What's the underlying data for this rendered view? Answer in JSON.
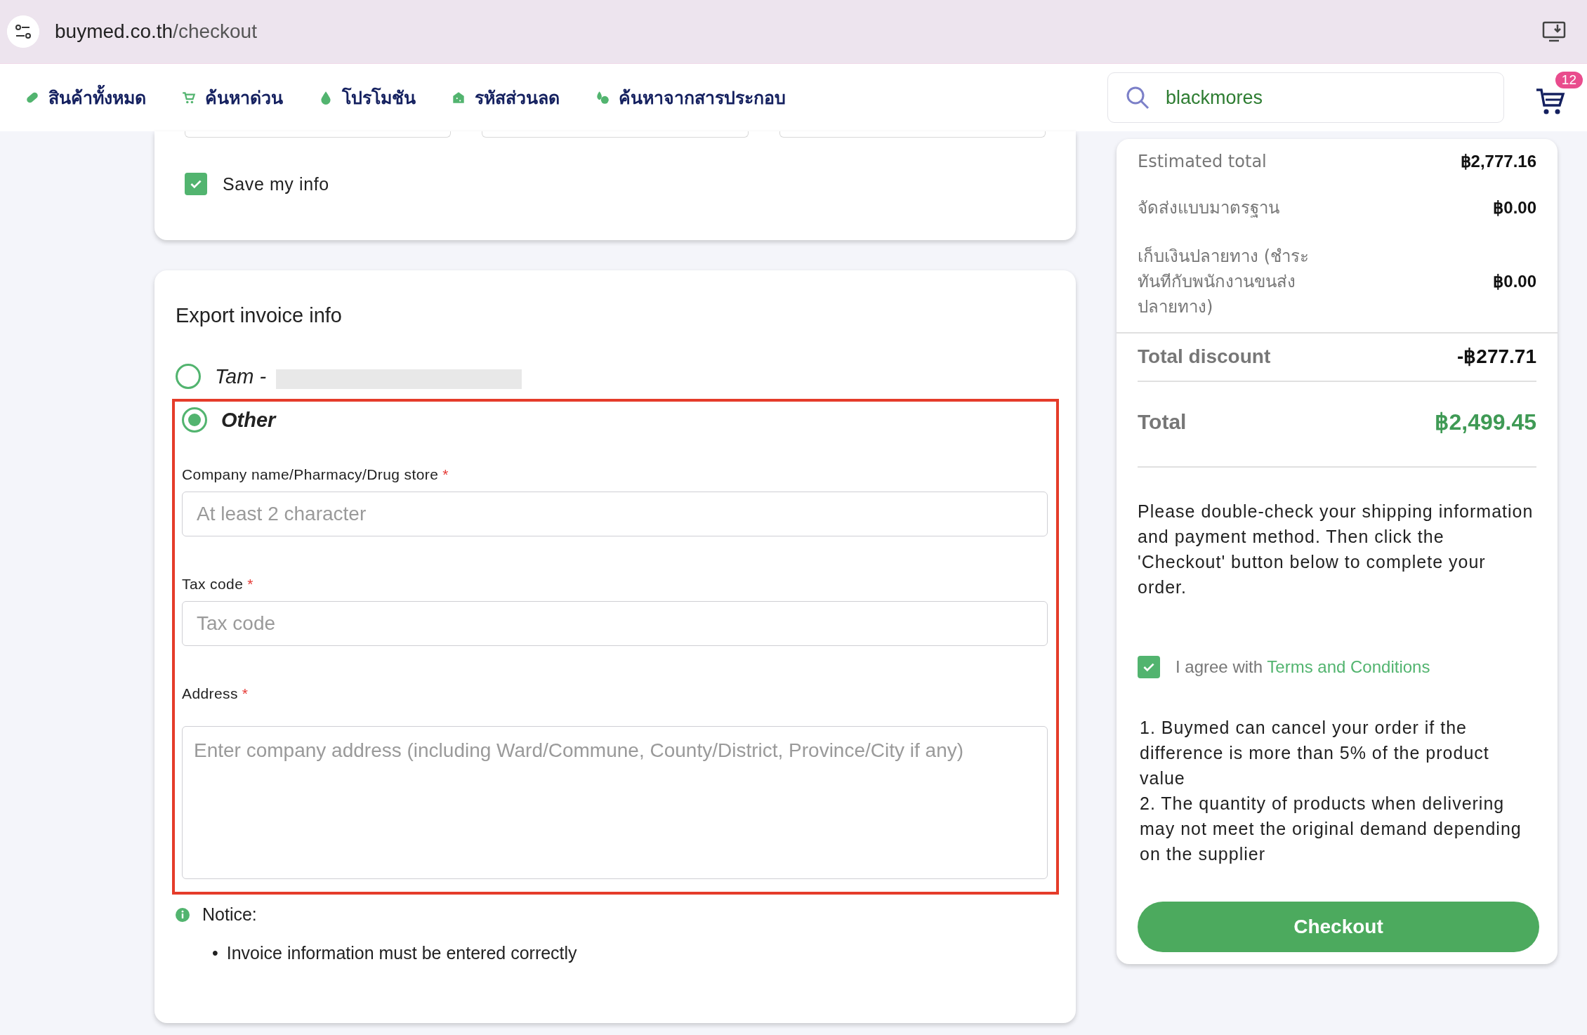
{
  "browser": {
    "url_host": "buymed.co.th",
    "url_path": "/checkout"
  },
  "nav": {
    "items": [
      {
        "label": "สินค้าทั้งหมด",
        "kind": "pill"
      },
      {
        "label": "ค้นหาด่วน",
        "kind": "cart"
      },
      {
        "label": "โปรโมชัน",
        "kind": "drop"
      },
      {
        "label": "รหัสส่วนลด",
        "kind": "tag"
      },
      {
        "label": "ค้นหาจากสารประกอบ",
        "kind": "leaves"
      }
    ],
    "search": {
      "value": "blackmores"
    },
    "cart_count": "12"
  },
  "save_info": {
    "label": "Save my info",
    "checked": true
  },
  "invoice": {
    "title": "Export invoice info",
    "options": [
      {
        "label": "Tam -",
        "selected": false,
        "redacted": true
      },
      {
        "label": "Other",
        "selected": true,
        "redacted": false
      }
    ],
    "fields": [
      {
        "label": "Company name/Pharmacy/Drug store",
        "required_mark": "*",
        "placeholder": "At least 2 character",
        "kind": "input"
      },
      {
        "label": "Tax code",
        "required_mark": "*",
        "placeholder": "Tax code",
        "kind": "input"
      },
      {
        "label": "Address",
        "required_mark": "*",
        "placeholder": "Enter company address (including Ward/Commune, County/District, Province/City if any)",
        "kind": "textarea"
      }
    ],
    "notice": {
      "title": "Notice:",
      "items": [
        {
          "bullet": "•",
          "text": "Invoice information must be entered correctly"
        }
      ]
    }
  },
  "summary": {
    "rows": [
      {
        "label": "Estimated total",
        "value": "฿2,777.16"
      },
      {
        "label": "จัดส่งแบบมาตรฐาน",
        "value": "฿0.00"
      },
      {
        "label": "เก็บเงินปลายทาง (ชำระทันทีกับพนักงานขนส่งปลายทาง)",
        "value": "฿0.00"
      }
    ],
    "discount": {
      "label": "Total discount",
      "value": "-฿277.71"
    },
    "total": {
      "label": "Total",
      "value": "฿2,499.45"
    },
    "message": "Please double-check your shipping information and payment method. Then click the 'Checkout' button below to complete your order.",
    "agree": {
      "checked": true,
      "text": "I agree with",
      "link": "Terms and Conditions"
    },
    "terms": [
      "1. Buymed can cancel your order if the difference is more than 5% of the product value",
      "2. The quantity of products when delivering may not meet the original demand depending on the supplier"
    ],
    "checkout": "Checkout"
  }
}
